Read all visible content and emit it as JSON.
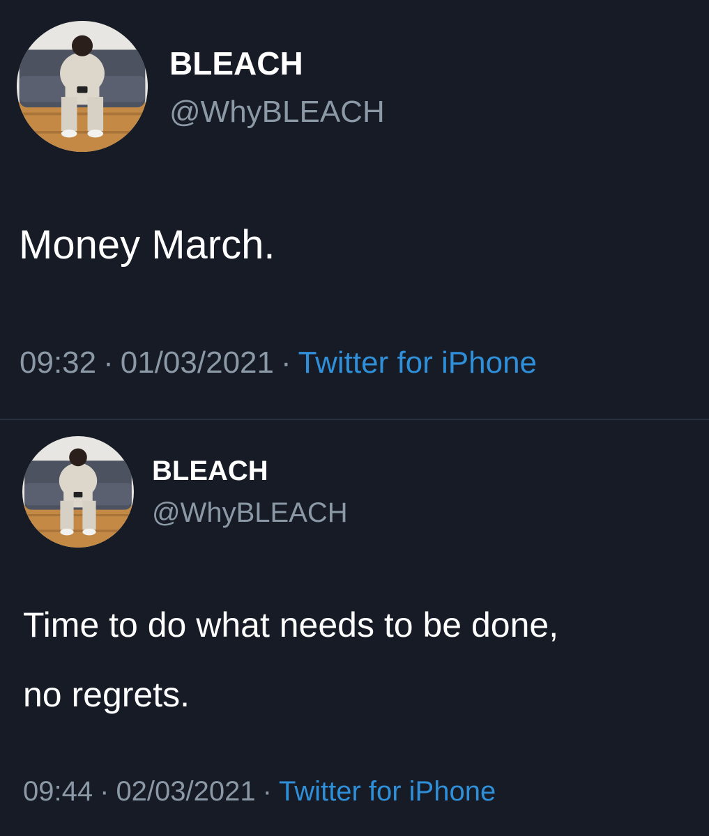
{
  "tweets": [
    {
      "display_name": "BLEACH",
      "handle": "@WhyBLEACH",
      "text_lines": [
        "Money March."
      ],
      "time": "09:32",
      "date": "01/03/2021",
      "separator": "·",
      "source": "Twitter for iPhone"
    },
    {
      "display_name": "BLEACH",
      "handle": "@WhyBLEACH",
      "text_lines": [
        "Time to do what needs to be done,",
        "no regrets."
      ],
      "time": "09:44",
      "date": "02/03/2021",
      "separator": "·",
      "source": "Twitter for iPhone"
    }
  ],
  "colors": {
    "background": "#161b26",
    "text_primary": "#ffffff",
    "text_secondary": "#8b98a5",
    "link": "#2f8fd8",
    "divider": "#2a3140"
  },
  "icons": {
    "avatar": "profile-photo-avatar"
  }
}
